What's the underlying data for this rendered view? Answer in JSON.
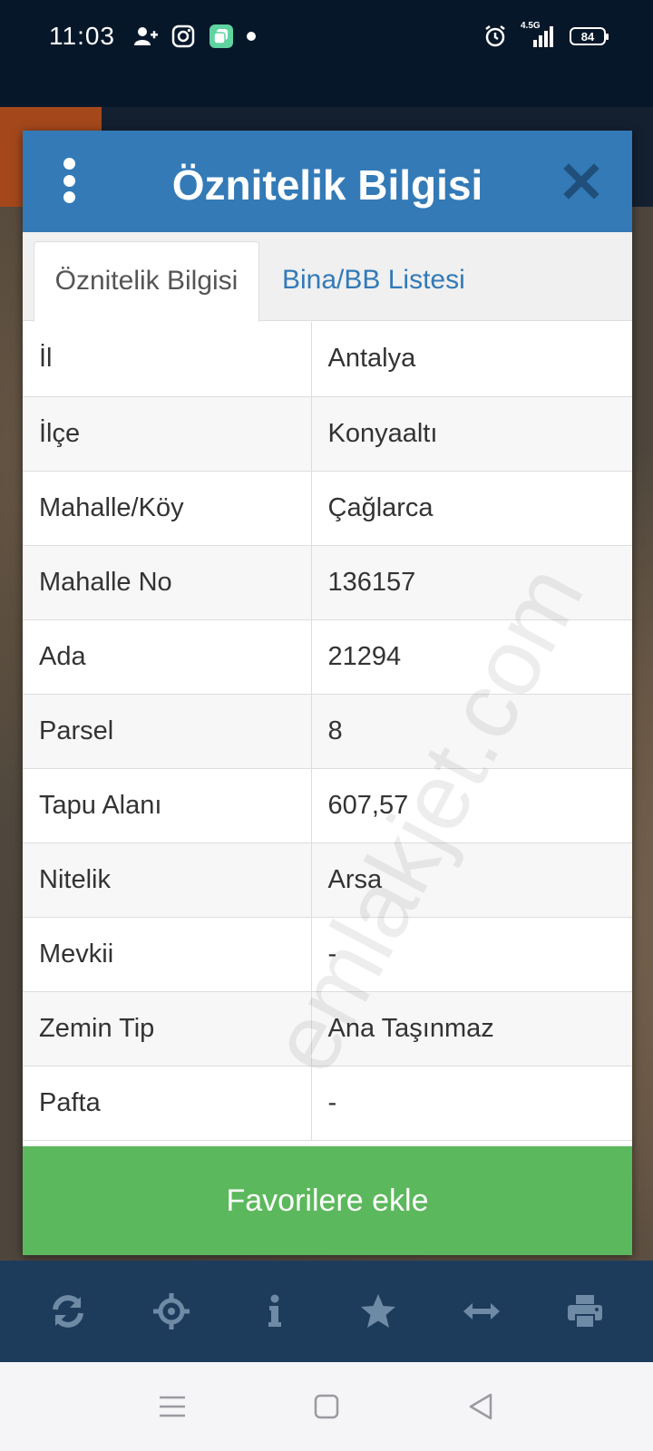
{
  "status_bar": {
    "time": "11:03",
    "network": "4.5G",
    "battery": "84"
  },
  "dialog": {
    "title": "Öznitelik Bilgisi",
    "tabs": [
      {
        "label": "Öznitelik Bilgisi",
        "active": true
      },
      {
        "label": "Bina/BB Listesi",
        "active": false
      }
    ],
    "rows": [
      {
        "key": "İl",
        "value": "Antalya"
      },
      {
        "key": "İlçe",
        "value": "Konyaaltı"
      },
      {
        "key": "Mahalle/Köy",
        "value": "Çağlarca"
      },
      {
        "key": "Mahalle No",
        "value": "136157"
      },
      {
        "key": "Ada",
        "value": "21294"
      },
      {
        "key": "Parsel",
        "value": "8"
      },
      {
        "key": "Tapu Alanı",
        "value": "607,57"
      },
      {
        "key": "Nitelik",
        "value": "Arsa"
      },
      {
        "key": "Mevkii",
        "value": "-"
      },
      {
        "key": "Zemin Tip",
        "value": "Ana Taşınmaz"
      },
      {
        "key": "Pafta",
        "value": "-"
      }
    ],
    "favorite_button": "Favorilere ekle"
  },
  "watermark": "emlakjet.com",
  "toolbar": {
    "icons": [
      "refresh-icon",
      "locate-icon",
      "info-icon",
      "star-icon",
      "measure-icon",
      "print-icon"
    ]
  },
  "colors": {
    "header": "#337ab7",
    "favorite": "#5cb85c",
    "toolbar": "#1d3c5c",
    "status_bar": "#07172a"
  }
}
